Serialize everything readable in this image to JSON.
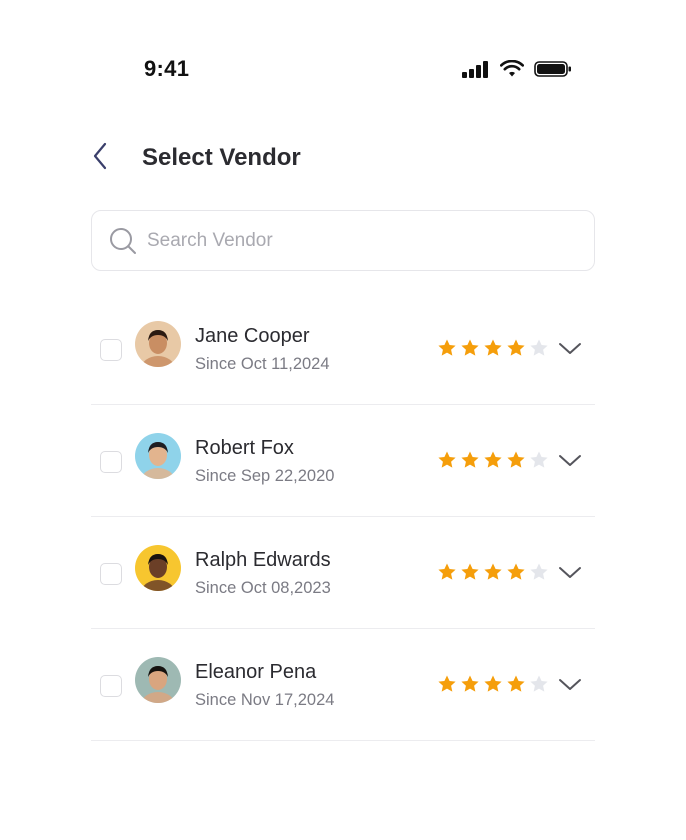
{
  "status_bar": {
    "time": "9:41"
  },
  "header": {
    "title": "Select Vendor"
  },
  "search": {
    "placeholder": "Search Vendor",
    "value": ""
  },
  "colors": {
    "star_filled": "#F59E0B",
    "star_empty": "#E4E6EB",
    "title": "#2B2B30",
    "subtext": "#7B7B84"
  },
  "vendors": [
    {
      "name": "Jane Cooper",
      "since": "Since Oct 11,2024",
      "rating": 4,
      "rating_max": 5,
      "checked": false,
      "avatar_bg": "#E8C9A6",
      "avatar_skin": "#C98E63",
      "avatar_hair": "#2B1A12"
    },
    {
      "name": "Robert Fox",
      "since": "Since Sep 22,2020",
      "rating": 4,
      "rating_max": 5,
      "checked": false,
      "avatar_bg": "#8FD3EA",
      "avatar_skin": "#E2B48E",
      "avatar_hair": "#1E1E22"
    },
    {
      "name": "Ralph Edwards",
      "since": "Since Oct 08,2023",
      "rating": 4,
      "rating_max": 5,
      "checked": false,
      "avatar_bg": "#F7C62F",
      "avatar_skin": "#6B3F27",
      "avatar_hair": "#1A1210"
    },
    {
      "name": "Eleanor Pena",
      "since": "Since Nov 17,2024",
      "rating": 4,
      "rating_max": 5,
      "checked": false,
      "avatar_bg": "#9EB9B3",
      "avatar_skin": "#D9A57F",
      "avatar_hair": "#15120F"
    }
  ]
}
